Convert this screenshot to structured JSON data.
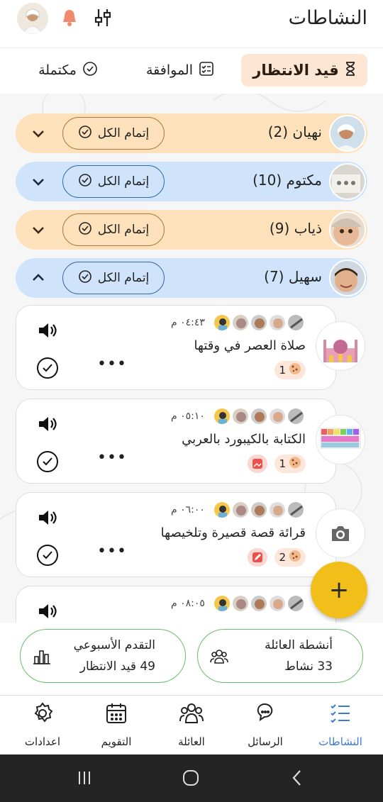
{
  "header": {
    "title": "النشاطات"
  },
  "tabs": {
    "pending": "قيد الانتظار",
    "approval": "الموافقة",
    "done": "مكتملة"
  },
  "groups": [
    {
      "name": "نهيان (2)",
      "action": "إتمام الكل",
      "color": "orange",
      "expanded": false
    },
    {
      "name": "مكتوم (10)",
      "action": "إتمام الكل",
      "color": "blue",
      "expanded": false
    },
    {
      "name": "ذياب (9)",
      "action": "إتمام الكل",
      "color": "orange",
      "expanded": false
    },
    {
      "name": "سهيل (7)",
      "action": "إتمام الكل",
      "color": "blue",
      "expanded": true
    }
  ],
  "activities": [
    {
      "title": "صلاة العصر في وقتها",
      "time": "٠٤:٤٣ م",
      "points": "1",
      "thumb": "mosque-icon"
    },
    {
      "title": "الكتابة بالكيبورد بالعربي",
      "time": "٠٥:١٠ م",
      "points": "1",
      "thumb": "keyboard-icon"
    },
    {
      "title": "قرائة قصة قصيرة وتلخيصها",
      "time": "٠٦:٠٠ م",
      "points": "2",
      "thumb": "camera-icon"
    },
    {
      "title": "",
      "time": "٠٨:٠٥ م",
      "points": "",
      "thumb": "mosque-icon"
    }
  ],
  "stats": {
    "family_title": "أنشطة العائلة",
    "family_value": "33 نشاط",
    "weekly_title": "التقدم الأسبوعي",
    "weekly_value": "49 قيد الانتظار"
  },
  "nav": {
    "activities": "النشاطات",
    "messages": "الرسائل",
    "family": "العائلة",
    "calendar": "التقويم",
    "settings": "اعدادات"
  },
  "colors": {
    "accent_orange": "#fde1bb",
    "accent_blue": "#cfe3fa",
    "fab": "#f2be1a",
    "nav_active": "#3a7bd5",
    "stat_border": "#6bbb6b"
  }
}
